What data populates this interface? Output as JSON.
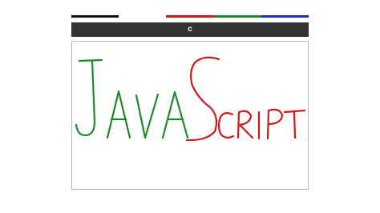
{
  "palette": {
    "colors": [
      "#111111",
      "#d01a1a",
      "#1d8a2a",
      "#1f2fc4"
    ]
  },
  "toolbar": {
    "clear_label": "c"
  },
  "drawing": {
    "stroke_colors": {
      "javascript_part1": "#1d8a2a",
      "javascript_part2": "#d01a1a"
    }
  }
}
